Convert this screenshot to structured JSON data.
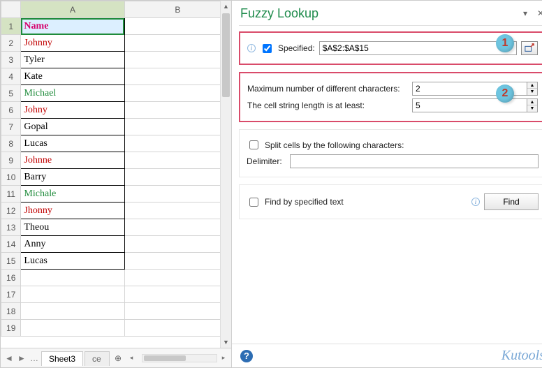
{
  "sheet": {
    "columns": [
      "A",
      "B"
    ],
    "selected_cell": "A1",
    "rows": [
      {
        "n": 1,
        "a": "Name",
        "cls": "header-cell",
        "bordered": true
      },
      {
        "n": 2,
        "a": "Johnny",
        "cls": "red",
        "bordered": true
      },
      {
        "n": 3,
        "a": "Tyler",
        "cls": "",
        "bordered": true
      },
      {
        "n": 4,
        "a": "Kate",
        "cls": "",
        "bordered": true
      },
      {
        "n": 5,
        "a": "Michael",
        "cls": "green",
        "bordered": true
      },
      {
        "n": 6,
        "a": "Johny",
        "cls": "red",
        "bordered": true
      },
      {
        "n": 7,
        "a": "Gopal",
        "cls": "",
        "bordered": true
      },
      {
        "n": 8,
        "a": "Lucas",
        "cls": "",
        "bordered": true
      },
      {
        "n": 9,
        "a": "Johnne",
        "cls": "red",
        "bordered": true
      },
      {
        "n": 10,
        "a": "Barry",
        "cls": "",
        "bordered": true
      },
      {
        "n": 11,
        "a": "Michale",
        "cls": "green",
        "bordered": true
      },
      {
        "n": 12,
        "a": "Jhonny",
        "cls": "red",
        "bordered": true
      },
      {
        "n": 13,
        "a": "Theou",
        "cls": "",
        "bordered": true
      },
      {
        "n": 14,
        "a": "Anny",
        "cls": "",
        "bordered": true
      },
      {
        "n": 15,
        "a": "Lucas",
        "cls": "",
        "bordered": true
      },
      {
        "n": 16,
        "a": "",
        "cls": "",
        "bordered": false
      },
      {
        "n": 17,
        "a": "",
        "cls": "",
        "bordered": false
      },
      {
        "n": 18,
        "a": "",
        "cls": "",
        "bordered": false
      },
      {
        "n": 19,
        "a": "",
        "cls": "",
        "bordered": false
      }
    ],
    "tabs": {
      "active": "Sheet3",
      "next_partial": "ce",
      "nav_prev": "◄",
      "nav_next": "►",
      "nav_more": "…",
      "add": "⊕"
    }
  },
  "pane": {
    "title": "Fuzzy Lookup",
    "controls": {
      "menu": "▾",
      "close": "✕"
    },
    "specified": {
      "label": "Specified:",
      "checked": true,
      "value": "$A$2:$A$15",
      "callout": "1"
    },
    "params": {
      "max_diff_label": "Maximum number of different characters:",
      "max_diff_value": "2",
      "min_len_label": "The cell string length is at least:",
      "min_len_value": "5",
      "callout": "2"
    },
    "split": {
      "label": "Split cells by the following characters:",
      "checked": false,
      "delimiter_label": "Delimiter:",
      "delimiter_value": ""
    },
    "findby": {
      "label": "Find by specified text",
      "checked": false,
      "button": "Find"
    },
    "footer": {
      "help": "?",
      "brand": "Kutools"
    }
  }
}
